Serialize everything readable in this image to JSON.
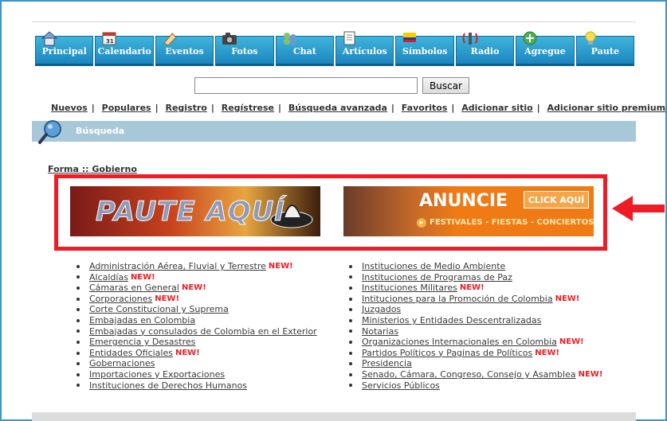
{
  "nav": [
    {
      "label": "Principal",
      "icon": "home-icon"
    },
    {
      "label": "Calendario",
      "icon": "calendar-icon"
    },
    {
      "label": "Eventos",
      "icon": "events-icon"
    },
    {
      "label": "Fotos",
      "icon": "camera-icon"
    },
    {
      "label": "Chat",
      "icon": "chat-icon"
    },
    {
      "label": "Artículos",
      "icon": "articles-icon"
    },
    {
      "label": "Símbolos",
      "icon": "flag-icon"
    },
    {
      "label": "Radio",
      "icon": "radio-icon"
    },
    {
      "label": "Agregue",
      "icon": "add-icon"
    },
    {
      "label": "Paute",
      "icon": "lightbulb-icon"
    }
  ],
  "search": {
    "value": "",
    "button": "Buscar"
  },
  "links": [
    "Nuevos",
    "Populares",
    "Registro",
    "Regístrese",
    "Búsqueda avanzada",
    "Favoritos",
    "Adicionar sitio",
    "Adicionar sitio premium"
  ],
  "section": {
    "title": "Búsqueda"
  },
  "breadcrumb": "Forma :: Gobierno",
  "banners": {
    "left": {
      "text": "PAUTE AQUÍ"
    },
    "right": {
      "headline": "ANUNCIE",
      "cta": "CLICK AQUÍ",
      "subtitle": "FESTIVALES - FIESTAS - CONCIERTOS"
    }
  },
  "badge_text": "NEW!",
  "left_list": [
    {
      "label": "Administración Aérea, Fluvial y Terrestre",
      "new": true
    },
    {
      "label": "Alcaldías",
      "new": true
    },
    {
      "label": "Cámaras en General",
      "new": true
    },
    {
      "label": "Corporaciones",
      "new": true
    },
    {
      "label": "Corte Constitucional y Suprema",
      "new": false
    },
    {
      "label": "Embajadas en Colombia",
      "new": false
    },
    {
      "label": "Embajadas y consulados de Colombia en el Exterior",
      "new": false
    },
    {
      "label": "Emergencia y Desastres",
      "new": false
    },
    {
      "label": "Entidades Oficiales",
      "new": true
    },
    {
      "label": "Gobernaciones",
      "new": false
    },
    {
      "label": "Importaciones y Exportaciones",
      "new": false
    },
    {
      "label": "Instituciones de Derechos Humanos",
      "new": false
    }
  ],
  "right_list": [
    {
      "label": "Instituciones de Medio Ambiente",
      "new": false
    },
    {
      "label": "Instituciones de Programas de Paz",
      "new": false
    },
    {
      "label": "Instituciones Militares",
      "new": true
    },
    {
      "label": "Intituciones para la Promoción de Colombia",
      "new": true
    },
    {
      "label": "Juzgados",
      "new": false
    },
    {
      "label": "Ministerios y Entidades Descentralizadas",
      "new": false
    },
    {
      "label": "Notarias",
      "new": false
    },
    {
      "label": "Organizaciones Internacionales en Colombia",
      "new": true
    },
    {
      "label": "Partidos Políticos y Paginas de Políticos",
      "new": true
    },
    {
      "label": "Presidencia",
      "new": false
    },
    {
      "label": "Senado, Cámara, Congreso, Consejo y Asamblea",
      "new": true
    },
    {
      "label": "Servicios Públicos",
      "new": false
    }
  ],
  "colors": {
    "nav_blue": "#1b86bf",
    "section_bar": "#a7c8d8",
    "highlight_red": "#ee1c24",
    "frame_blue": "#3b95c9"
  }
}
